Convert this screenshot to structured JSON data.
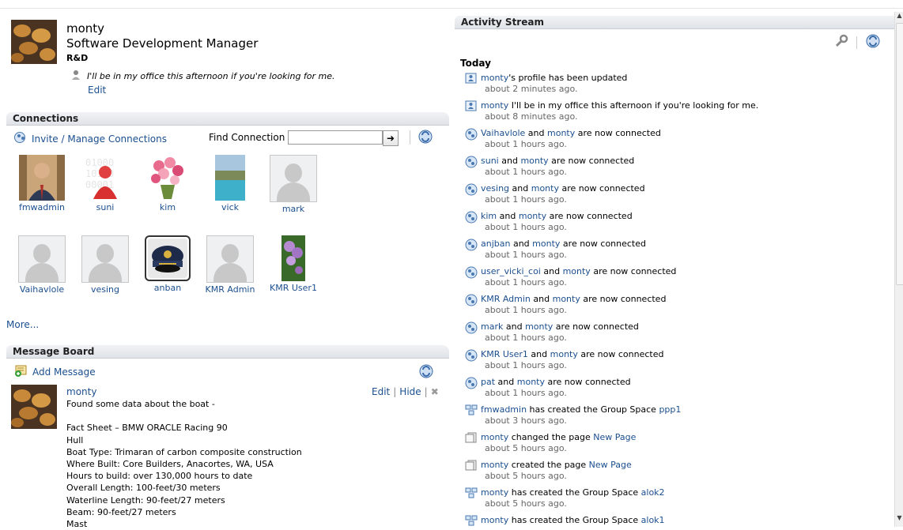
{
  "profile": {
    "name": "monty",
    "title": "Software Development Manager",
    "department": "R&D",
    "status": "I'll be in my office this afternoon if you're looking for me.",
    "edit": "Edit"
  },
  "connections": {
    "header": "Connections",
    "invite": "Invite / Manage Connections",
    "find_label": "Find Connection",
    "find_value": "",
    "more": "More...",
    "people": [
      {
        "name": "fmwadmin",
        "avatar": "photo-man"
      },
      {
        "name": "suni",
        "avatar": "red-figure"
      },
      {
        "name": "kim",
        "avatar": "flowers"
      },
      {
        "name": "vick",
        "avatar": "pool"
      },
      {
        "name": "mark",
        "avatar": "placeholder"
      },
      {
        "name": "Vaihavlole",
        "avatar": "placeholder"
      },
      {
        "name": "vesing",
        "avatar": "placeholder"
      },
      {
        "name": "anban",
        "avatar": "captain-hat"
      },
      {
        "name": "KMR Admin",
        "avatar": "placeholder"
      },
      {
        "name": "KMR User1",
        "avatar": "purple-flowers"
      }
    ]
  },
  "message_board": {
    "header": "Message Board",
    "add": "Add Message",
    "author": "monty",
    "edit": "Edit",
    "hide": "Hide",
    "sep": "|",
    "lines": [
      "Found some data about the boat -",
      "",
      "Fact Sheet – BMW ORACLE Racing 90",
      "Hull",
      "Boat Type: Trimaran of carbon composite construction",
      "Where Built: Core Builders, Anacortes, WA, USA",
      "Hours to build: over 130,000 hours to date",
      "Overall Length: 100-feet/30 meters",
      "Waterline Length: 90-feet/27 meters",
      "Beam: 90-feet/27 meters",
      "Mast"
    ]
  },
  "activity": {
    "header": "Activity Stream",
    "today": "Today",
    "items": [
      {
        "icon": "profile",
        "parts": [
          {
            "t": "monty",
            "link": true
          },
          {
            "t": "'s profile has been updated",
            "link": false
          }
        ],
        "time": "about 2 minutes ago."
      },
      {
        "icon": "profile",
        "parts": [
          {
            "t": "monty",
            "link": true
          },
          {
            "t": " I'll be in my office this afternoon if you're looking for me.",
            "link": false
          }
        ],
        "time": "about 8 minutes ago."
      },
      {
        "icon": "connection",
        "parts": [
          {
            "t": "Vaihavlole",
            "link": true
          },
          {
            "t": " and ",
            "link": false
          },
          {
            "t": "monty",
            "link": true
          },
          {
            "t": " are now connected",
            "link": false
          }
        ],
        "time": "about 1 hours ago."
      },
      {
        "icon": "connection",
        "parts": [
          {
            "t": "suni",
            "link": true
          },
          {
            "t": " and ",
            "link": false
          },
          {
            "t": "monty",
            "link": true
          },
          {
            "t": " are now connected",
            "link": false
          }
        ],
        "time": "about 1 hours ago."
      },
      {
        "icon": "connection",
        "parts": [
          {
            "t": "vesing",
            "link": true
          },
          {
            "t": " and ",
            "link": false
          },
          {
            "t": "monty",
            "link": true
          },
          {
            "t": " are now connected",
            "link": false
          }
        ],
        "time": "about 1 hours ago."
      },
      {
        "icon": "connection",
        "parts": [
          {
            "t": "kim",
            "link": true
          },
          {
            "t": " and ",
            "link": false
          },
          {
            "t": "monty",
            "link": true
          },
          {
            "t": " are now connected",
            "link": false
          }
        ],
        "time": "about 1 hours ago."
      },
      {
        "icon": "connection",
        "parts": [
          {
            "t": "anjban",
            "link": true
          },
          {
            "t": " and ",
            "link": false
          },
          {
            "t": "monty",
            "link": true
          },
          {
            "t": " are now connected",
            "link": false
          }
        ],
        "time": "about 1 hours ago."
      },
      {
        "icon": "connection",
        "parts": [
          {
            "t": "user_vicki_coi",
            "link": true
          },
          {
            "t": " and ",
            "link": false
          },
          {
            "t": "monty",
            "link": true
          },
          {
            "t": " are now connected",
            "link": false
          }
        ],
        "time": "about 1 hours ago."
      },
      {
        "icon": "connection",
        "parts": [
          {
            "t": "KMR Admin",
            "link": true
          },
          {
            "t": " and ",
            "link": false
          },
          {
            "t": "monty",
            "link": true
          },
          {
            "t": " are now connected",
            "link": false
          }
        ],
        "time": "about 1 hours ago."
      },
      {
        "icon": "connection",
        "parts": [
          {
            "t": "mark",
            "link": true
          },
          {
            "t": " and ",
            "link": false
          },
          {
            "t": "monty",
            "link": true
          },
          {
            "t": " are now connected",
            "link": false
          }
        ],
        "time": "about 1 hours ago."
      },
      {
        "icon": "connection",
        "parts": [
          {
            "t": "KMR User1",
            "link": true
          },
          {
            "t": " and ",
            "link": false
          },
          {
            "t": "monty",
            "link": true
          },
          {
            "t": " are now connected",
            "link": false
          }
        ],
        "time": "about 1 hours ago."
      },
      {
        "icon": "connection",
        "parts": [
          {
            "t": "pat",
            "link": true
          },
          {
            "t": " and ",
            "link": false
          },
          {
            "t": "monty",
            "link": true
          },
          {
            "t": " are now connected",
            "link": false
          }
        ],
        "time": "about 1 hours ago."
      },
      {
        "icon": "group-space",
        "parts": [
          {
            "t": "fmwadmin",
            "link": true
          },
          {
            "t": " has created the Group Space ",
            "link": false
          },
          {
            "t": "ppp1",
            "link": true
          }
        ],
        "time": "about 3 hours ago."
      },
      {
        "icon": "page",
        "parts": [
          {
            "t": "monty",
            "link": true
          },
          {
            "t": " changed the page ",
            "link": false
          },
          {
            "t": "New Page",
            "link": true
          }
        ],
        "time": "about 5 hours ago."
      },
      {
        "icon": "page",
        "parts": [
          {
            "t": "monty",
            "link": true
          },
          {
            "t": " created the page ",
            "link": false
          },
          {
            "t": "New Page",
            "link": true
          }
        ],
        "time": "about 5 hours ago."
      },
      {
        "icon": "group-space",
        "parts": [
          {
            "t": "monty",
            "link": true
          },
          {
            "t": " has created the Group Space ",
            "link": false
          },
          {
            "t": "alok2",
            "link": true
          }
        ],
        "time": "about 5 hours ago."
      },
      {
        "icon": "group-space",
        "parts": [
          {
            "t": "monty",
            "link": true
          },
          {
            "t": " has created the Group Space ",
            "link": false
          },
          {
            "t": "alok1",
            "link": true
          }
        ],
        "time": ""
      }
    ]
  },
  "colors": {
    "link": "#1b4f8f",
    "header_bg": "#e4e7eb",
    "time": "#666666"
  }
}
